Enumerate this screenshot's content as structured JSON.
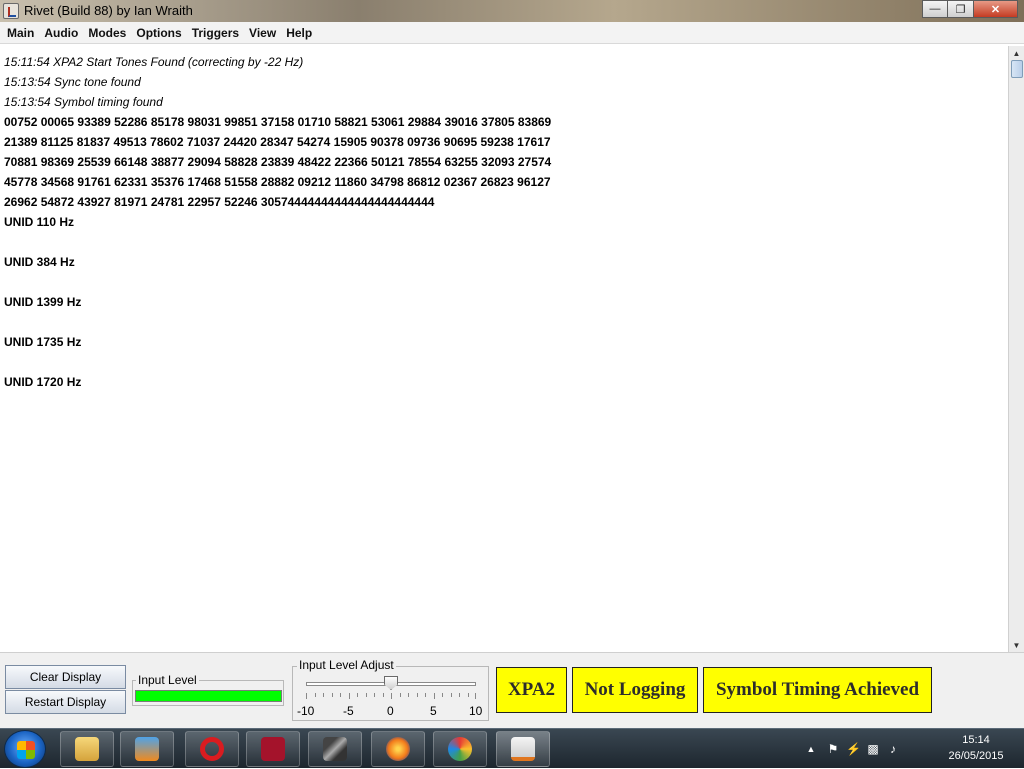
{
  "window": {
    "title": "Rivet (Build 88) by Ian Wraith"
  },
  "menu": [
    "Main",
    "Audio",
    "Modes",
    "Options",
    "Triggers",
    "View",
    "Help"
  ],
  "log": [
    {
      "text": "15:11:54 XPA2 Start Tones Found (correcting by -22 Hz)",
      "style": "italic"
    },
    {
      "text": "15:13:54 Sync tone found",
      "style": "italic"
    },
    {
      "text": "15:13:54 Symbol timing found",
      "style": "italic"
    },
    {
      "text": "00752 00065 93389 52286 85178 98031 99851 37158 01710 58821 53061 29884 39016 37805 83869",
      "style": "bold"
    },
    {
      "text": "21389 81125 81837 49513 78602 71037 24420 28347 54274 15905 90378 09736 90695 59238 17617",
      "style": "bold"
    },
    {
      "text": "70881 98369 25539 66148 38877 29094 58828 23839 48422 22366 50121 78554 63255 32093 27574",
      "style": "bold"
    },
    {
      "text": "45778 34568 91761 62331 35376 17468 51558 28882 09212 11860 34798 86812 02367 26823 96127",
      "style": "bold"
    },
    {
      "text": "26962 54872 43927 81971 24781 22957 52246 30574444444444444444444444",
      "style": "bold"
    },
    {
      "text": "UNID 110 Hz",
      "style": "bold"
    },
    {
      "text": "",
      "style": "empty"
    },
    {
      "text": "UNID 384 Hz",
      "style": "bold"
    },
    {
      "text": "",
      "style": "empty"
    },
    {
      "text": "UNID 1399 Hz",
      "style": "bold"
    },
    {
      "text": "",
      "style": "empty"
    },
    {
      "text": "UNID 1735 Hz",
      "style": "bold"
    },
    {
      "text": "",
      "style": "empty"
    },
    {
      "text": "UNID 1720 Hz",
      "style": "bold"
    }
  ],
  "controls": {
    "clear_label": "Clear Display",
    "restart_label": "Restart Display",
    "input_level_label": "Input Level",
    "input_level_value": 1.0,
    "input_adjust_label": "Input Level Adjust",
    "slider": {
      "min": -10,
      "max": 10,
      "value": 0,
      "tick_labels": [
        "-10",
        "-5",
        "0",
        "5",
        "10"
      ]
    }
  },
  "status": {
    "mode": "XPA2",
    "logging": "Not Logging",
    "timing": "Symbol Timing Achieved",
    "color": "#ffff00"
  },
  "taskbar": {
    "apps": [
      "explorer-icon",
      "media-player-icon",
      "opera-icon",
      "mendeley-icon",
      "microphone-icon",
      "firefox-icon",
      "paint-icon",
      "java-icon"
    ],
    "time": "15:14",
    "date": "26/05/2015"
  }
}
